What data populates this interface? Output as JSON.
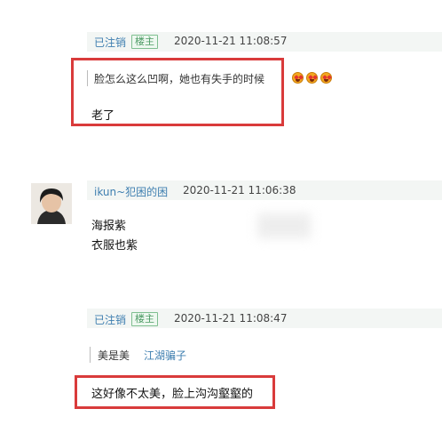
{
  "post1": {
    "username": "已注销",
    "badge": "楼主",
    "timestamp": "2020-11-21 11:08:57",
    "quote": "脸怎么这么凹啊，她也有失手的时候",
    "emoji": [
      "star-struck-emoji",
      "star-struck-emoji",
      "star-struck-emoji"
    ],
    "reply": "老了"
  },
  "post2": {
    "username": "ikun~犯困的困",
    "timestamp": "2020-11-21 11:06:38",
    "lines": [
      "海报紫",
      "衣服也紫"
    ]
  },
  "post3": {
    "username": "已注销",
    "badge": "楼主",
    "timestamp": "2020-11-21 11:08:47",
    "quote_text": "美是美",
    "quote_user": "江湖骗子",
    "reply": "这好像不太美，脸上沟沟壑壑的"
  },
  "colors": {
    "highlight_box": "#d93b3b",
    "username": "#3f7fb0",
    "badge": "#4b9a63"
  }
}
